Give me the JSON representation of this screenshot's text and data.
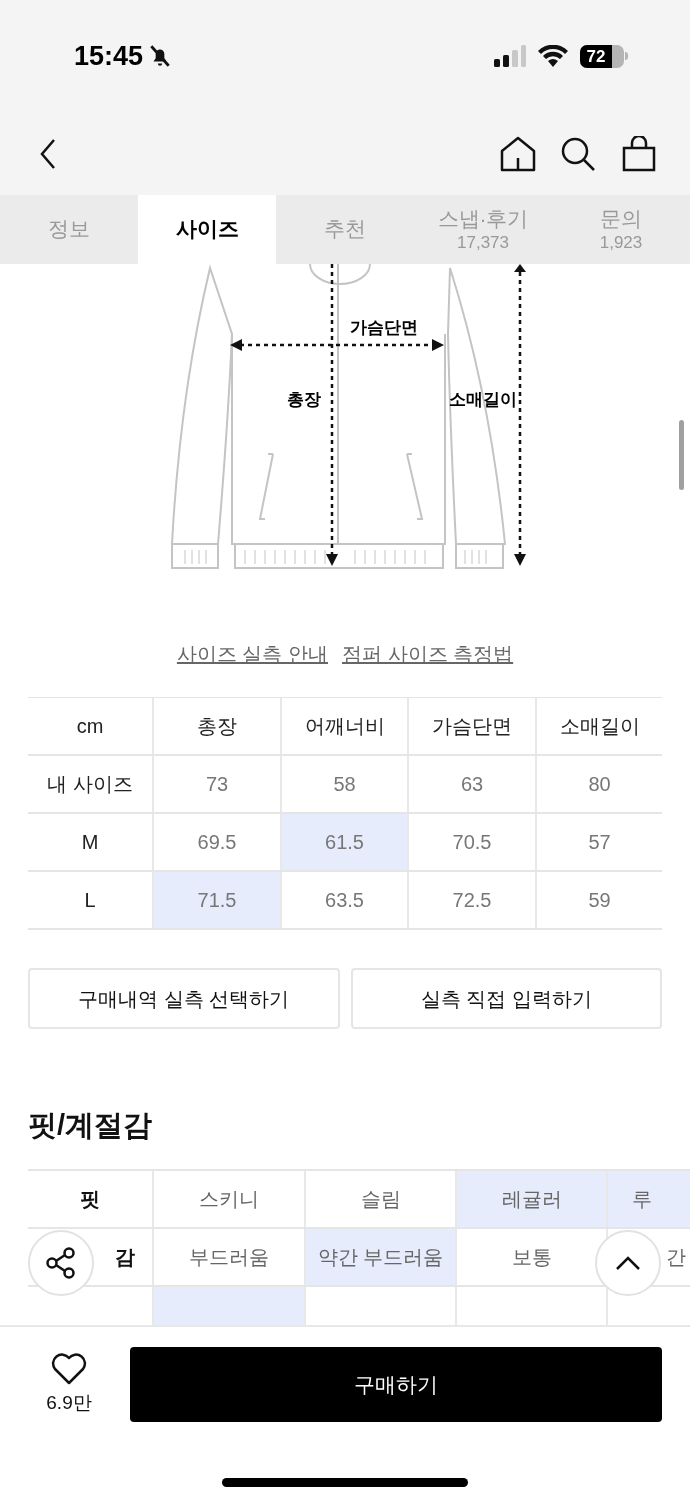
{
  "status_bar": {
    "time": "15:45",
    "battery": "72"
  },
  "tabs": [
    {
      "label": "정보",
      "selected": false
    },
    {
      "label": "사이즈",
      "selected": true
    },
    {
      "label": "추천",
      "selected": false
    },
    {
      "label": "스냅·후기",
      "count": "17,373",
      "selected": false
    },
    {
      "label": "문의",
      "count": "1,923",
      "selected": false
    }
  ],
  "diagram": {
    "chest": "가슴단면",
    "length": "총장",
    "sleeve": "소매길이"
  },
  "links": [
    "사이즈 실측 안내",
    "점퍼 사이즈 측정법"
  ],
  "size_table": {
    "corner": "cm",
    "columns": [
      "총장",
      "어깨너비",
      "가슴단면",
      "소매길이"
    ],
    "rows": [
      {
        "label": "내 사이즈",
        "cells": [
          {
            "text": "73",
            "selected": false
          },
          {
            "text": "58",
            "selected": false
          },
          {
            "text": "63",
            "selected": false
          },
          {
            "text": "80",
            "selected": false
          }
        ]
      },
      {
        "label": "M",
        "cells": [
          {
            "text": "69.5",
            "selected": false
          },
          {
            "text": "61.5",
            "selected": true
          },
          {
            "text": "70.5",
            "selected": false
          },
          {
            "text": "57",
            "selected": false
          }
        ]
      },
      {
        "label": "L",
        "cells": [
          {
            "text": "71.5",
            "selected": true
          },
          {
            "text": "63.5",
            "selected": false
          },
          {
            "text": "72.5",
            "selected": false
          },
          {
            "text": "59",
            "selected": false
          }
        ]
      }
    ]
  },
  "actions": [
    "구매내역 실측 선택하기",
    "실측 직접 입력하기"
  ],
  "fit_section": {
    "title": "핏/계절감",
    "rows": [
      {
        "label": "핏",
        "cells": [
          {
            "text": "스키니",
            "selected": false
          },
          {
            "text": "슬림",
            "selected": false
          },
          {
            "text": "레귤러",
            "selected": true
          },
          {
            "text": "루",
            "selected": true
          }
        ]
      },
      {
        "label": "감",
        "cells": [
          {
            "text": "부드러움",
            "selected": false
          },
          {
            "text": "약간 부드러움",
            "selected": true
          },
          {
            "text": "보통",
            "selected": false
          },
          {
            "text": "간",
            "selected": false
          }
        ]
      },
      {
        "cells": [
          {
            "selected": true
          },
          {
            "selected": false
          },
          {
            "selected": false
          },
          {
            "selected": false
          }
        ]
      }
    ]
  },
  "bottom_bar": {
    "likes": "6.9만",
    "buy": "구매하기"
  }
}
